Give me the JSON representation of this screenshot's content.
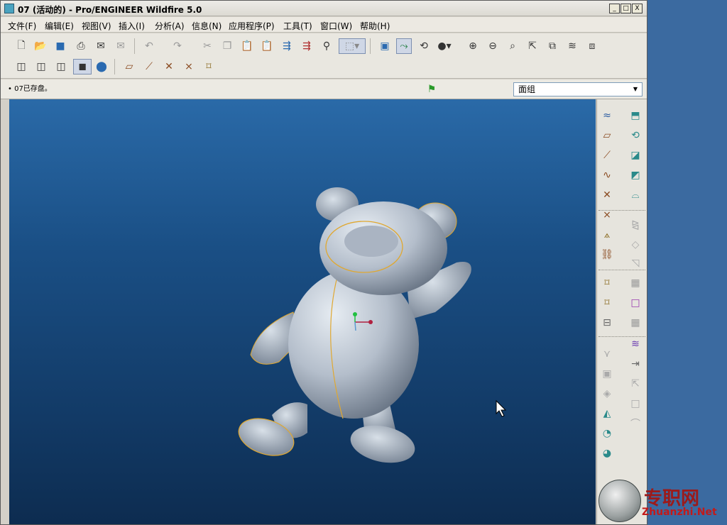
{
  "window": {
    "title": "07 (活动的) - Pro/ENGINEER Wildfire 5.0",
    "minimize": "_",
    "maximize": "□",
    "close": "X"
  },
  "menu": [
    "文件(F)",
    "编辑(E)",
    "视图(V)",
    "插入(I)",
    "分析(A)",
    "信息(N)",
    "应用程序(P)",
    "工具(T)",
    "窗口(W)",
    "帮助(H)"
  ],
  "status": {
    "message": "07已存盘。",
    "filter_value": "面组",
    "filter_arrow": "▼"
  },
  "watermark": {
    "text": "专职网",
    "sub": "Zhuanzhi.Net"
  },
  "colors": {
    "model": "#b9c3cf",
    "edge_highlight": "#e0a830",
    "viewport_top": "#2a6aa8",
    "viewport_bottom": "#0d2c50"
  },
  "toolbar_icons": {
    "row1": [
      "new-file-icon",
      "open-icon",
      "save-icon",
      "print-icon",
      "email-icon",
      "email-link-icon",
      "undo-icon",
      "redo-icon",
      "cut-icon",
      "copy-icon",
      "paste-icon",
      "paste-special-icon",
      "regenerate-icon",
      "regen-manager-icon",
      "find-icon",
      "select-box-icon",
      "repaint-icon",
      "spin-center-icon",
      "orient-icon",
      "appearance-icon",
      "zoom-in-icon",
      "zoom-out-icon",
      "refit-icon",
      "reorient-icon",
      "saved-views-icon",
      "layers-icon",
      "view-manager-icon"
    ],
    "row2": [
      "wireframe-icon",
      "hidden-line-icon",
      "no-hidden-icon",
      "shading-icon",
      "enhanced-realism-icon",
      "datum-plane-toggle-icon",
      "datum-axis-toggle-icon",
      "datum-point-toggle-icon",
      "csys-toggle-icon",
      "annotation-toggle-icon"
    ]
  },
  "right_icons": [
    "sketched-curve-icon",
    "datum-plane-icon",
    "datum-axis-icon",
    "datum-curve-icon",
    "datum-point-icon",
    "csys-icon",
    "offset-csys-icon",
    "analysis-feature-icon",
    "annotation-icon",
    "note-icon",
    "sketch-icon",
    "extrude-icon",
    "revolve-icon",
    "sweep-icon",
    "blend-icon",
    "style-icon",
    "boundary-icon",
    "round-icon",
    "chamfer-icon",
    "shell-icon",
    "draft-icon",
    "mirror-icon",
    "merge-icon",
    "trim-icon",
    "pattern-icon",
    "extend-icon",
    "offset-icon",
    "thicken-icon",
    "solidify-icon",
    "project-icon",
    "wrap-icon",
    "intersect-icon"
  ]
}
